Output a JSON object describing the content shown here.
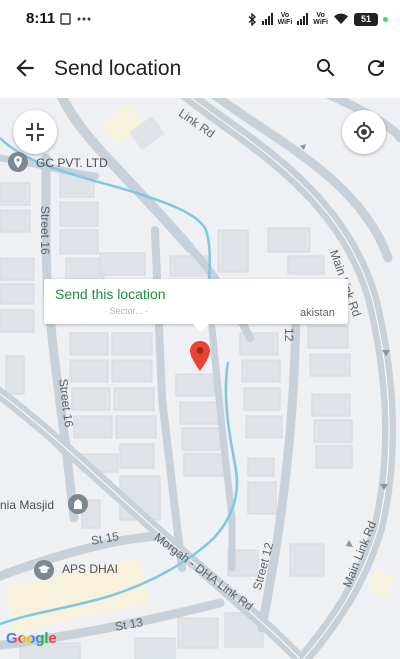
{
  "status_bar": {
    "time": "8:11",
    "icons_left": [
      "screenshot-icon",
      "more-dots-icon"
    ],
    "volte_label": "Vo",
    "wifi_label": "WiFi",
    "battery": "51"
  },
  "app_bar": {
    "title": "Send location",
    "icons": [
      "back-arrow-icon",
      "search-icon",
      "refresh-icon"
    ]
  },
  "map": {
    "popup": {
      "action": "Send this location",
      "address_faded": "· Sector... ·",
      "address_suffix": "akistan"
    },
    "roads": {
      "main_link_rd_top": "Main Link Rd",
      "main_link_rd_bottom": "Main Link Rd",
      "link_rd_top": "Link Rd",
      "street_16_top": "Street 16",
      "street_16_bottom": "Street 16",
      "street_12_top": "12",
      "street_12_bottom": "Street 12",
      "st_15": "St 15",
      "st_13": "St 13",
      "morgah_link": "Morgah - DHA Link Rd"
    },
    "places": {
      "gc": "GC PVT. LTD",
      "masjid": "nia Masjid",
      "aps": "APS DHAI"
    },
    "attribution": "Google",
    "colors": {
      "map_bg": "#eef0f3",
      "road": "#c8d0d9",
      "water": "#7ec8e3",
      "pin": "#ea4335",
      "popup_action": "#1e8e3e"
    }
  }
}
